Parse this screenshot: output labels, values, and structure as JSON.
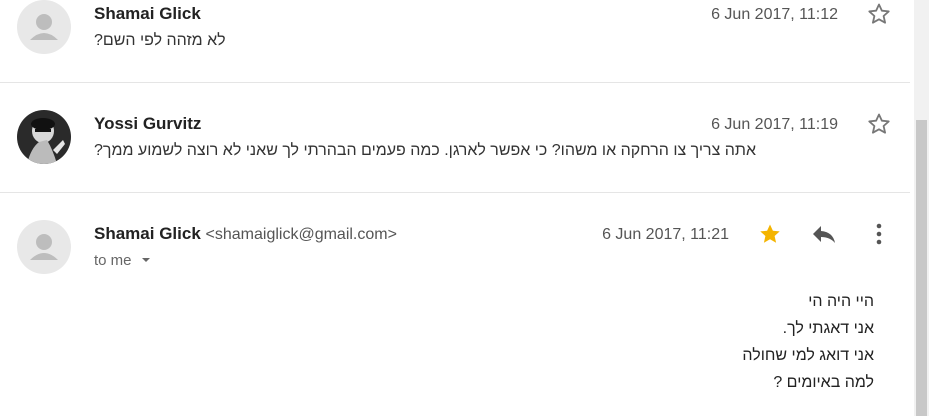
{
  "messages": [
    {
      "sender": "Shamai Glick",
      "date": "6 Jun 2017, 11:12",
      "snippet": "לא מזהה לפי השם?",
      "starred": false
    },
    {
      "sender": "Yossi Gurvitz",
      "date": "6 Jun 2017, 11:19",
      "snippet": "אתה צריך צו הרחקה או משהו? כי אפשר לארגן. כמה פעמים הבהרתי לך שאני לא רוצה לשמוע ממך?",
      "starred": false
    },
    {
      "sender": "Shamai Glick",
      "email": "<shamaiglick@gmail.com>",
      "date": "6 Jun 2017, 11:21",
      "recipient": "to me",
      "starred": true,
      "body": [
        "היי היה הי",
        "אני דאגתי לך.",
        "אני דואג למי שחולה",
        "למה באיומים ?"
      ]
    }
  ],
  "colors": {
    "star_active": "#f4b400",
    "icon": "#606060"
  },
  "icons": [
    "star-icon",
    "reply-icon",
    "more-options-icon",
    "dropdown-icon",
    "person-icon"
  ]
}
